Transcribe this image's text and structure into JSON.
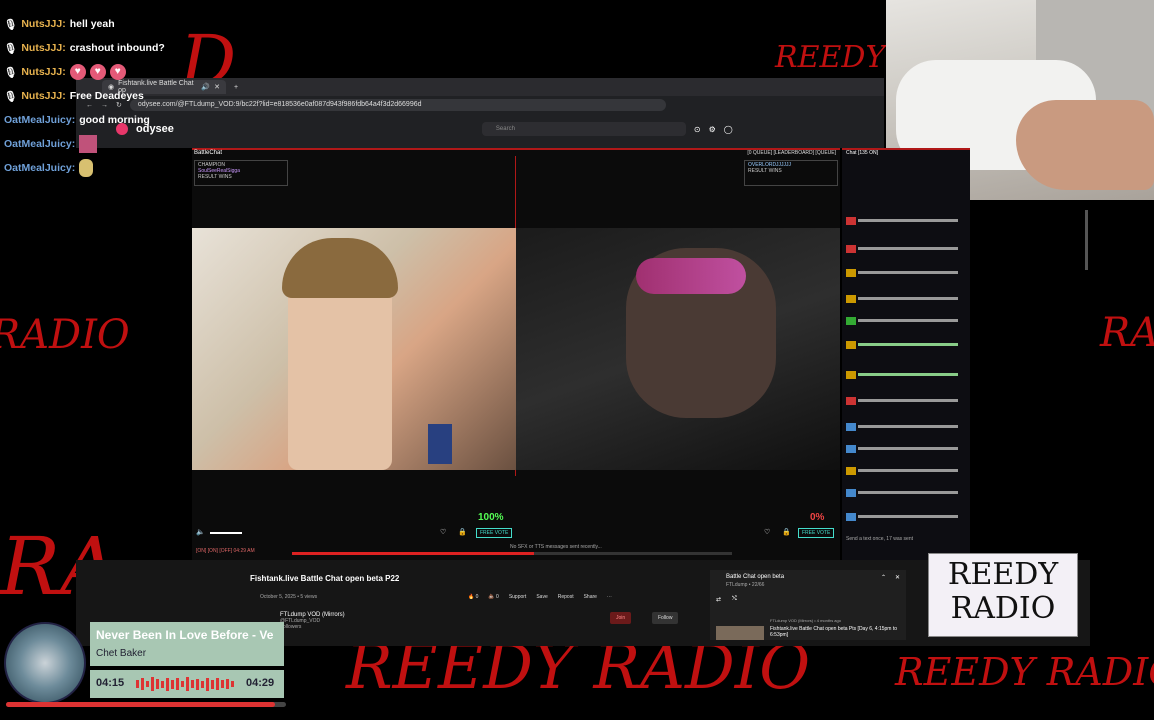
{
  "background": {
    "scrawl_text": [
      "REEDY RADIO",
      "REEDY RADIO",
      "REEDY",
      "RA",
      "RADIO",
      "RA",
      "RADIO"
    ],
    "accent": "#c01010"
  },
  "chat_overlay": [
    {
      "user": "NutsJJJ:",
      "message": "hell yeah"
    },
    {
      "user": "NutsJJJ:",
      "message": "crashout inbound?"
    },
    {
      "user": "NutsJJJ:",
      "message": "",
      "emotes": 3
    },
    {
      "user": "NutsJJJ:",
      "message": "Free Deadeyes"
    },
    {
      "user": "OatMealJuicy:",
      "message": "good morning"
    },
    {
      "user": "OatMealJuicy:",
      "message": ""
    },
    {
      "user": "OatMealJuicy:",
      "message": ""
    }
  ],
  "browser": {
    "tab_title": "Fishtank.live Battle Chat op",
    "url": "odysee.com/@FTLdump_VOD:9/bc22f?lid=e818536e0af087d943f986fdb64a4f3d2d66996d",
    "site": "odysee",
    "search_placeholder": "Search"
  },
  "battlechat": {
    "title": "BattleChat",
    "menu": "[0 QUEUE] [LEADERBOARD] [QUEUE]",
    "left_player": {
      "label": "CHAMPION",
      "name": "SoulSeeRealSigga",
      "stat": "RESULT WINS"
    },
    "right_player": {
      "label": "",
      "name": "OVERLORDJJJJJJ",
      "stat": "RESULT WINS"
    },
    "left_pct": "100%",
    "right_pct": "0%",
    "free_vote": "FREE VOTE",
    "timer": "19",
    "status": "No SFX or TTS messages sent recently...",
    "footer_left": "[ON] [ON] [OFF] 04:29 AM"
  },
  "chat_panel": {
    "title": "Chat [135 ON]",
    "footer": "Send a text once, 17 was sent"
  },
  "odysee_page": {
    "title": "Fishtank.live Battle Chat open beta P22",
    "date": "October 5, 2025",
    "views": "5 views",
    "actions": [
      "0",
      "0",
      "Support",
      "Save",
      "Repost",
      "Share"
    ],
    "channel": "FTLdump VOD (Mirrors)",
    "channel_handle": "@FTLdump_VOD",
    "followers": "Followers",
    "join_label": "Join",
    "follow_label": "Follow",
    "playlist": {
      "title": "Battle Chat open beta",
      "owner": "FTLdump • 22/66",
      "item_title": "Fishtank.live Battle Chat open beta Pts [Day 6, 4:15pm to 6:53pm]",
      "item_meta": "FTLdump VOD (Mirrors) • 4 months ago"
    }
  },
  "reedy_card": {
    "line1": "REEDY",
    "line2": "RADIO"
  },
  "music": {
    "title": "Never Been In Love Before - Ve",
    "artist": "Chet Baker",
    "elapsed": "04:15",
    "duration": "04:29",
    "progress": 0.96,
    "accent": "#d33333"
  }
}
